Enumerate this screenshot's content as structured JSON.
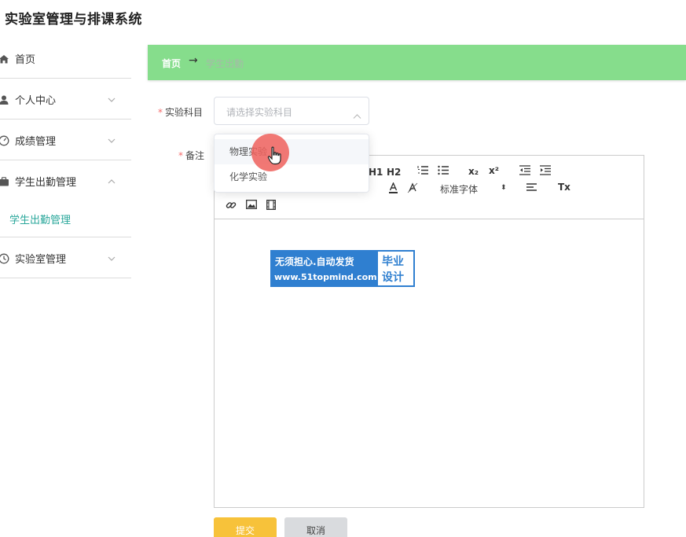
{
  "app": {
    "title": "实验室管理与排课系统"
  },
  "sidebar": {
    "items": [
      {
        "label": "首页",
        "icon": "home-icon"
      },
      {
        "label": "个人中心",
        "icon": "user-icon"
      },
      {
        "label": "成绩管理",
        "icon": "gauge-icon"
      },
      {
        "label": "学生出勤管理",
        "icon": "briefcase-icon",
        "expanded": true
      },
      {
        "label": "实验室管理",
        "icon": "clock-icon"
      }
    ],
    "submenu": {
      "label": "学生出勤管理",
      "color": "#2aa79b"
    }
  },
  "breadcrumb": {
    "home": "首页",
    "separator": "→",
    "current": "学生出勤"
  },
  "form": {
    "subject_label": "实验科目",
    "subject_placeholder": "请选择实验科目",
    "subject_options": [
      "物理实验",
      "化学实验"
    ],
    "remark_label": "备注",
    "required_mark": "*"
  },
  "editor": {
    "toolbar": {
      "h1": "H1",
      "h2": "H2",
      "subscript": "x₂",
      "superscript": "x²",
      "font": "标准字体",
      "font_arrow": "⬍",
      "clear_format": "Tx"
    }
  },
  "watermark": {
    "line1": "无须担心.自动发货",
    "line2": "www.51topmind.com",
    "right1": "毕业",
    "right2": "设计"
  },
  "buttons": {
    "submit": "提交",
    "cancel": "取消"
  },
  "colors": {
    "breadcrumb_bg": "#86dd8c",
    "accent": "#2aa79b",
    "submit_bg": "#f7c23a",
    "cancel_bg": "#d9dbde",
    "required": "#f56c6c"
  }
}
